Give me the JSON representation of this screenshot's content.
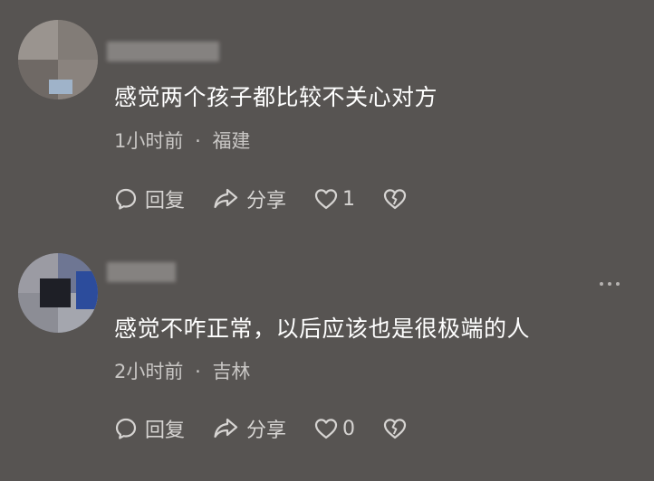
{
  "comments": [
    {
      "text": "感觉两个孩子都比较不关心对方",
      "time": "1小时前",
      "separator": "·",
      "location": "福建",
      "reply_label": "回复",
      "share_label": "分享",
      "like_count": "1"
    },
    {
      "text": "感觉不咋正常，以后应该也是很极端的人",
      "time": "2小时前",
      "separator": "·",
      "location": "吉林",
      "reply_label": "回复",
      "share_label": "分享",
      "like_count": "0"
    }
  ],
  "colors": {
    "background": "#575452",
    "primary_text": "#ffffff",
    "secondary_text": "#c9c7c5",
    "icon": "#d6d4d2"
  },
  "icons": [
    "reply-icon",
    "share-icon",
    "like-icon",
    "dislike-icon",
    "more-icon"
  ]
}
